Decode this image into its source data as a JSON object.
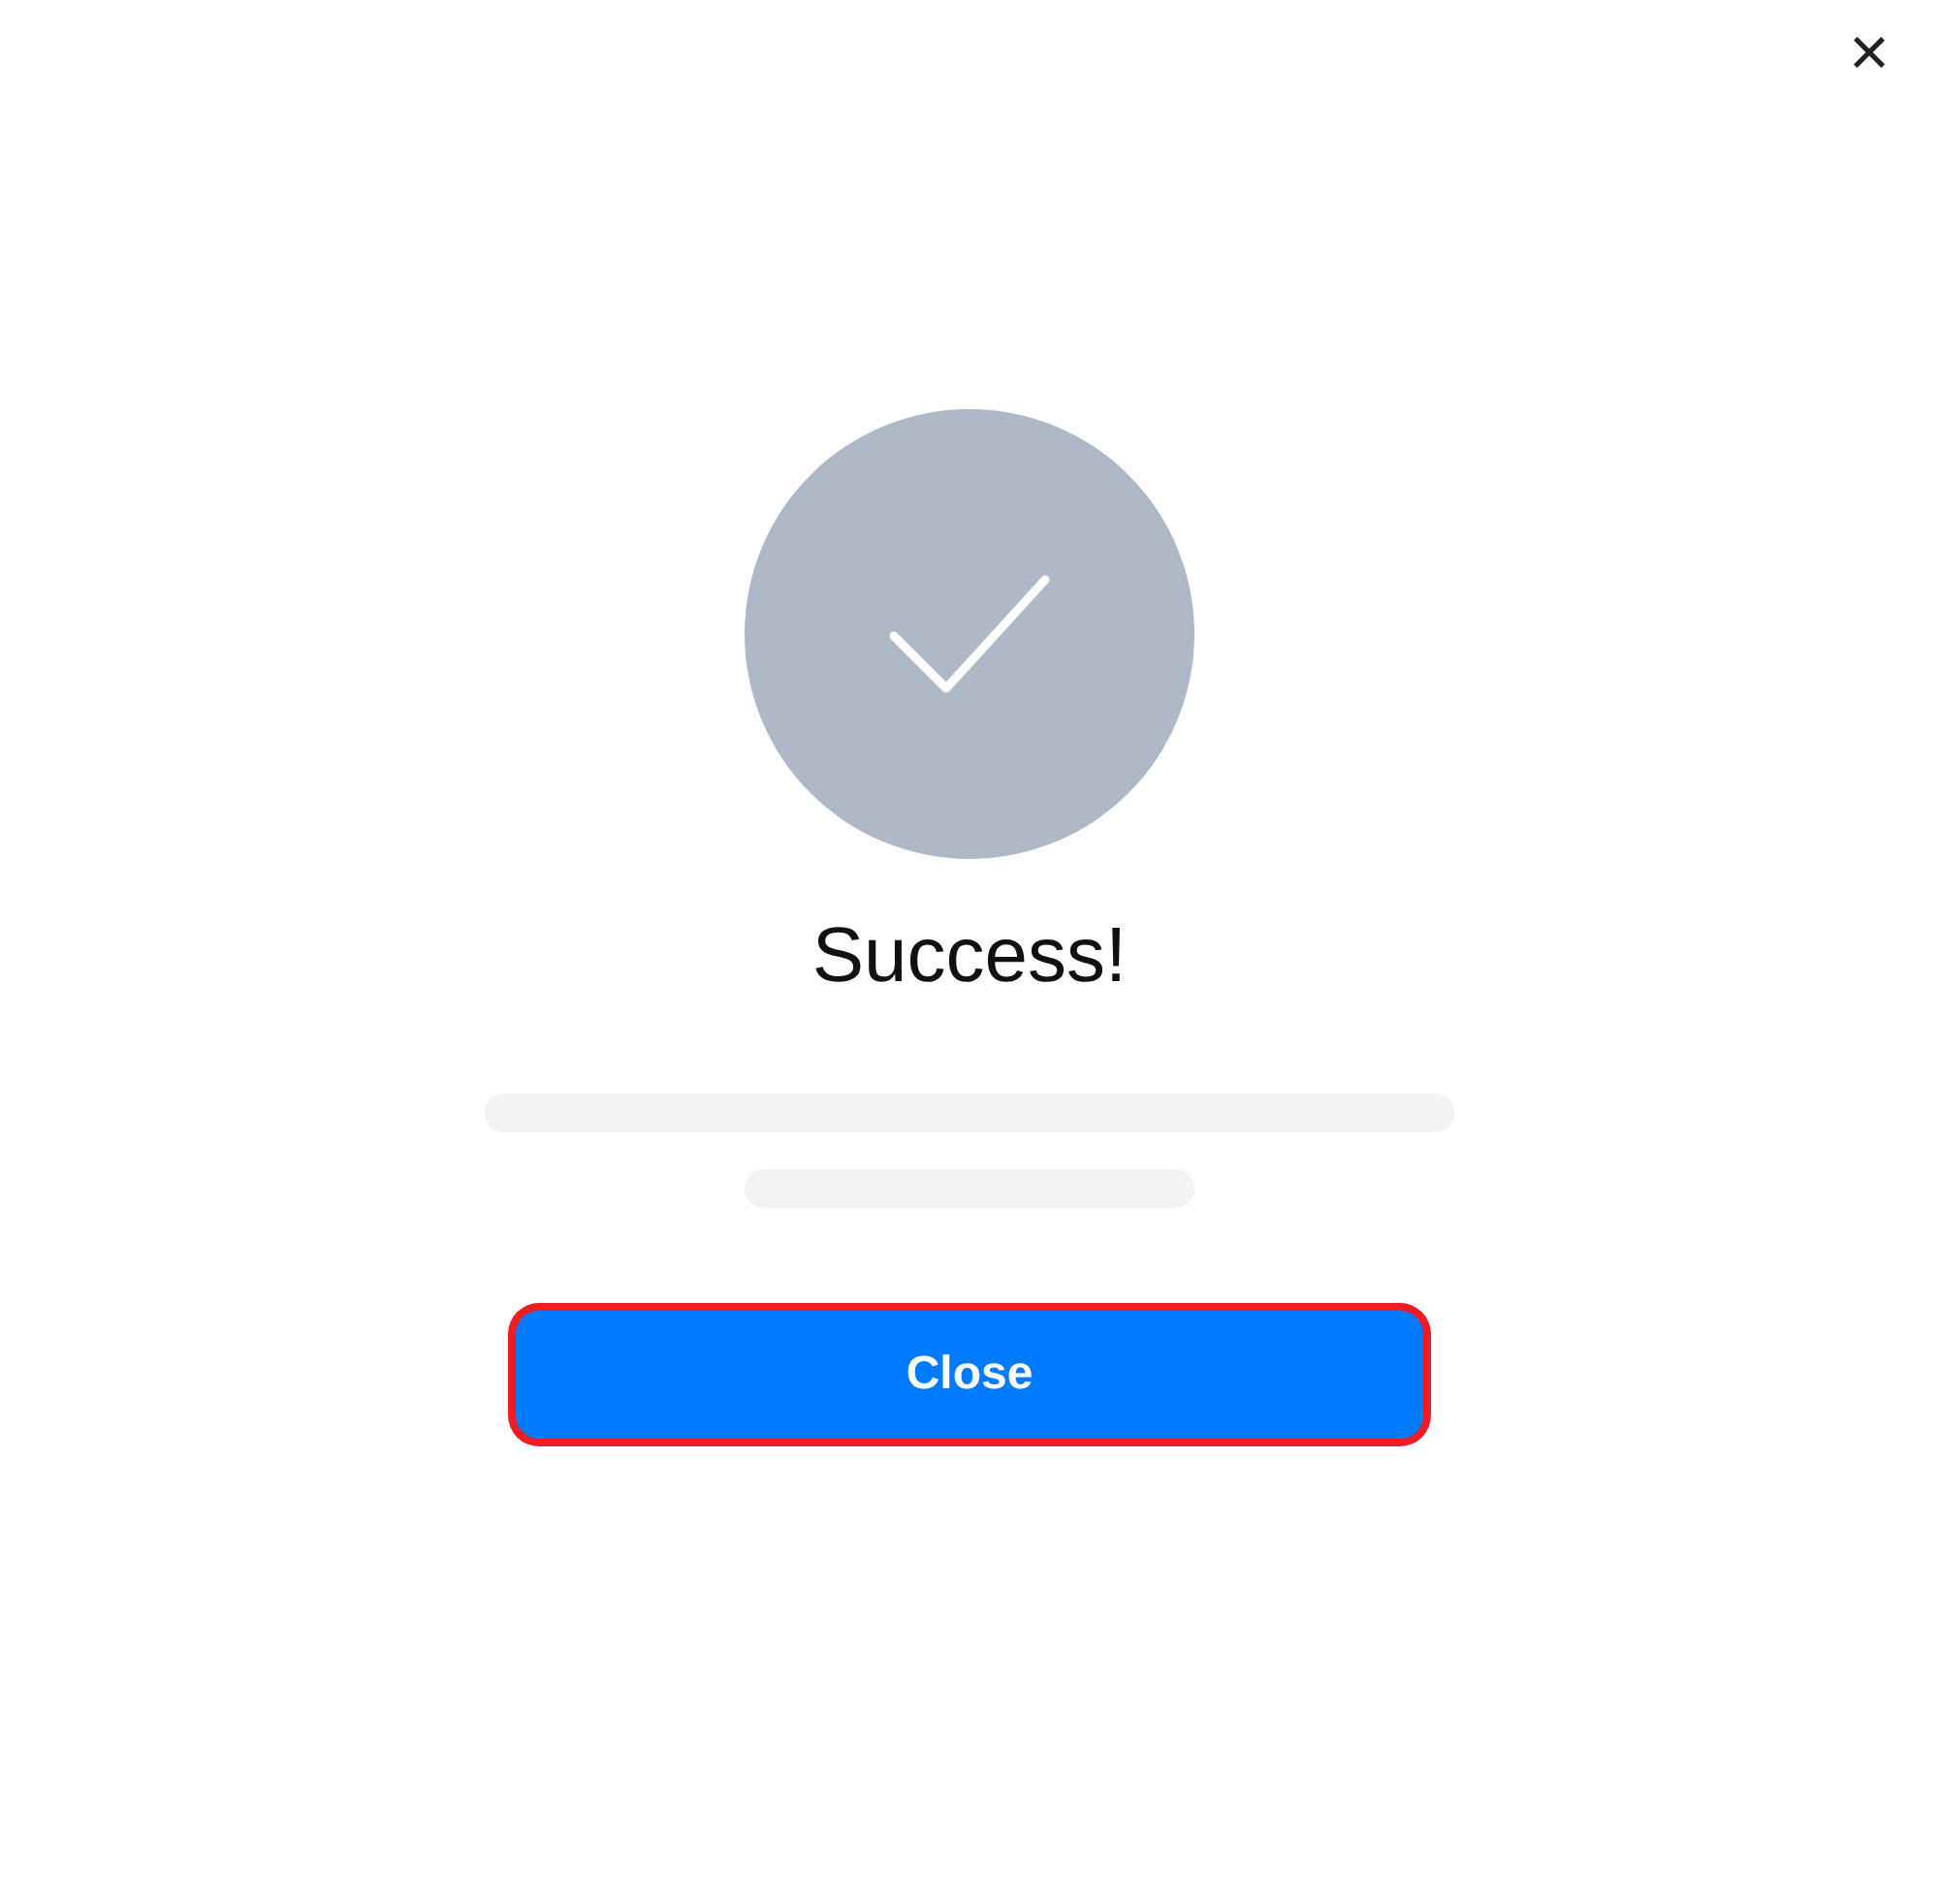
{
  "dialog": {
    "title": "Success!",
    "close_button": {
      "label": "×"
    },
    "button": {
      "label": "Close",
      "focused": true
    }
  }
}
